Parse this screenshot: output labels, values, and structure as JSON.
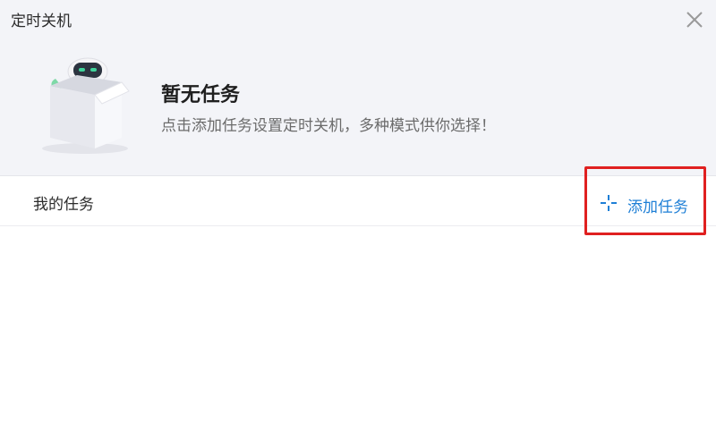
{
  "window": {
    "title": "定时关机"
  },
  "empty_state": {
    "title": "暂无任务",
    "description": "点击添加任务设置定时关机，多种模式供你选择！"
  },
  "section": {
    "label": "我的任务"
  },
  "actions": {
    "add_task_label": "添加任务",
    "add_icon": "plus-icon",
    "close_icon": "close-icon"
  },
  "colors": {
    "header_bg": "#f3f4f8",
    "accent": "#1e7fd6",
    "highlight_border": "#e02020"
  }
}
